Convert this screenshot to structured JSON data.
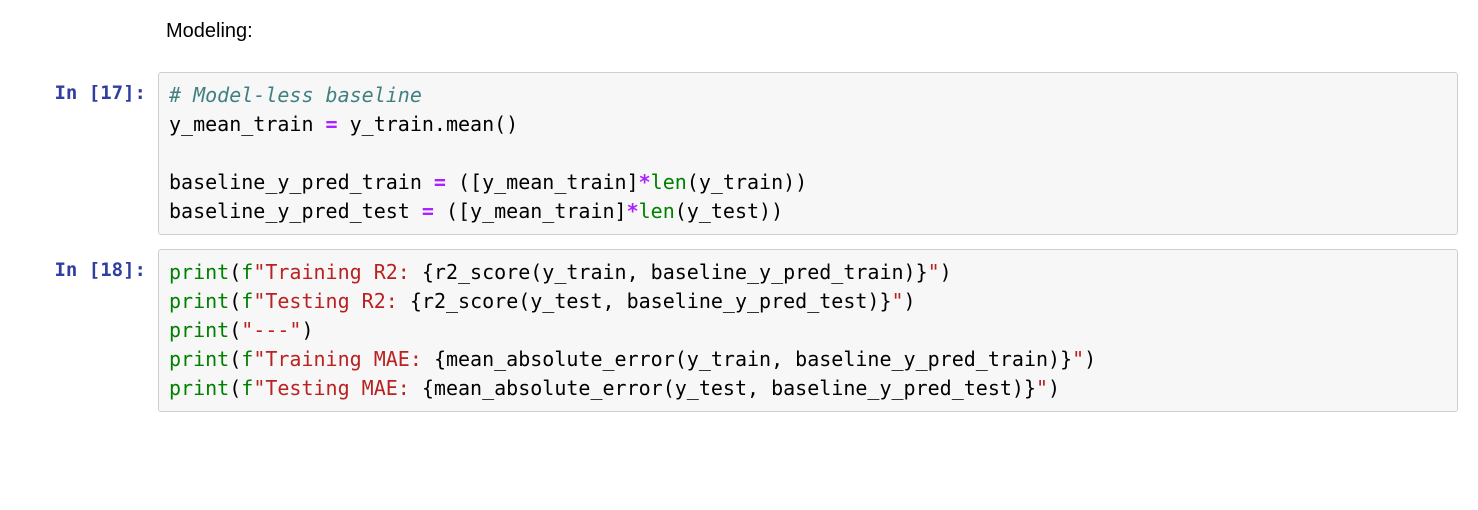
{
  "markdown": {
    "text": "Modeling:"
  },
  "cells": [
    {
      "prompt_label": "In [17]:",
      "lines": [
        {
          "c": "# Model-less baseline"
        },
        {
          "t": [
            "y_mean_train ",
            "=",
            " y_train.mean()"
          ]
        },
        {
          "blank": true
        },
        {
          "t": [
            "baseline_y_pred_train ",
            "=",
            " ([y_mean_train]",
            "*",
            "len",
            "(y_train))"
          ]
        },
        {
          "t": [
            "baseline_y_pred_test ",
            "=",
            " ([y_mean_train]",
            "*",
            "len",
            "(y_test))"
          ]
        }
      ]
    },
    {
      "prompt_label": "In [18]:",
      "lines": [
        {
          "p": [
            "print",
            "(",
            "f",
            "\"Training R2: ",
            "{r2_score(y_train, baseline_y_pred_train)}",
            "\"",
            ")"
          ]
        },
        {
          "p": [
            "print",
            "(",
            "f",
            "\"Testing R2: ",
            "{r2_score(y_test, baseline_y_pred_test)}",
            "\"",
            ")"
          ]
        },
        {
          "p": [
            "print",
            "(",
            "\"---\"",
            ")"
          ]
        },
        {
          "p": [
            "print",
            "(",
            "f",
            "\"Training MAE: ",
            "{mean_absolute_error(y_train, baseline_y_pred_train)}",
            "\"",
            ")"
          ]
        },
        {
          "p": [
            "print",
            "(",
            "f",
            "\"Testing MAE: ",
            "{mean_absolute_error(y_test, baseline_y_pred_test)}",
            "\"",
            ")"
          ]
        }
      ]
    }
  ]
}
